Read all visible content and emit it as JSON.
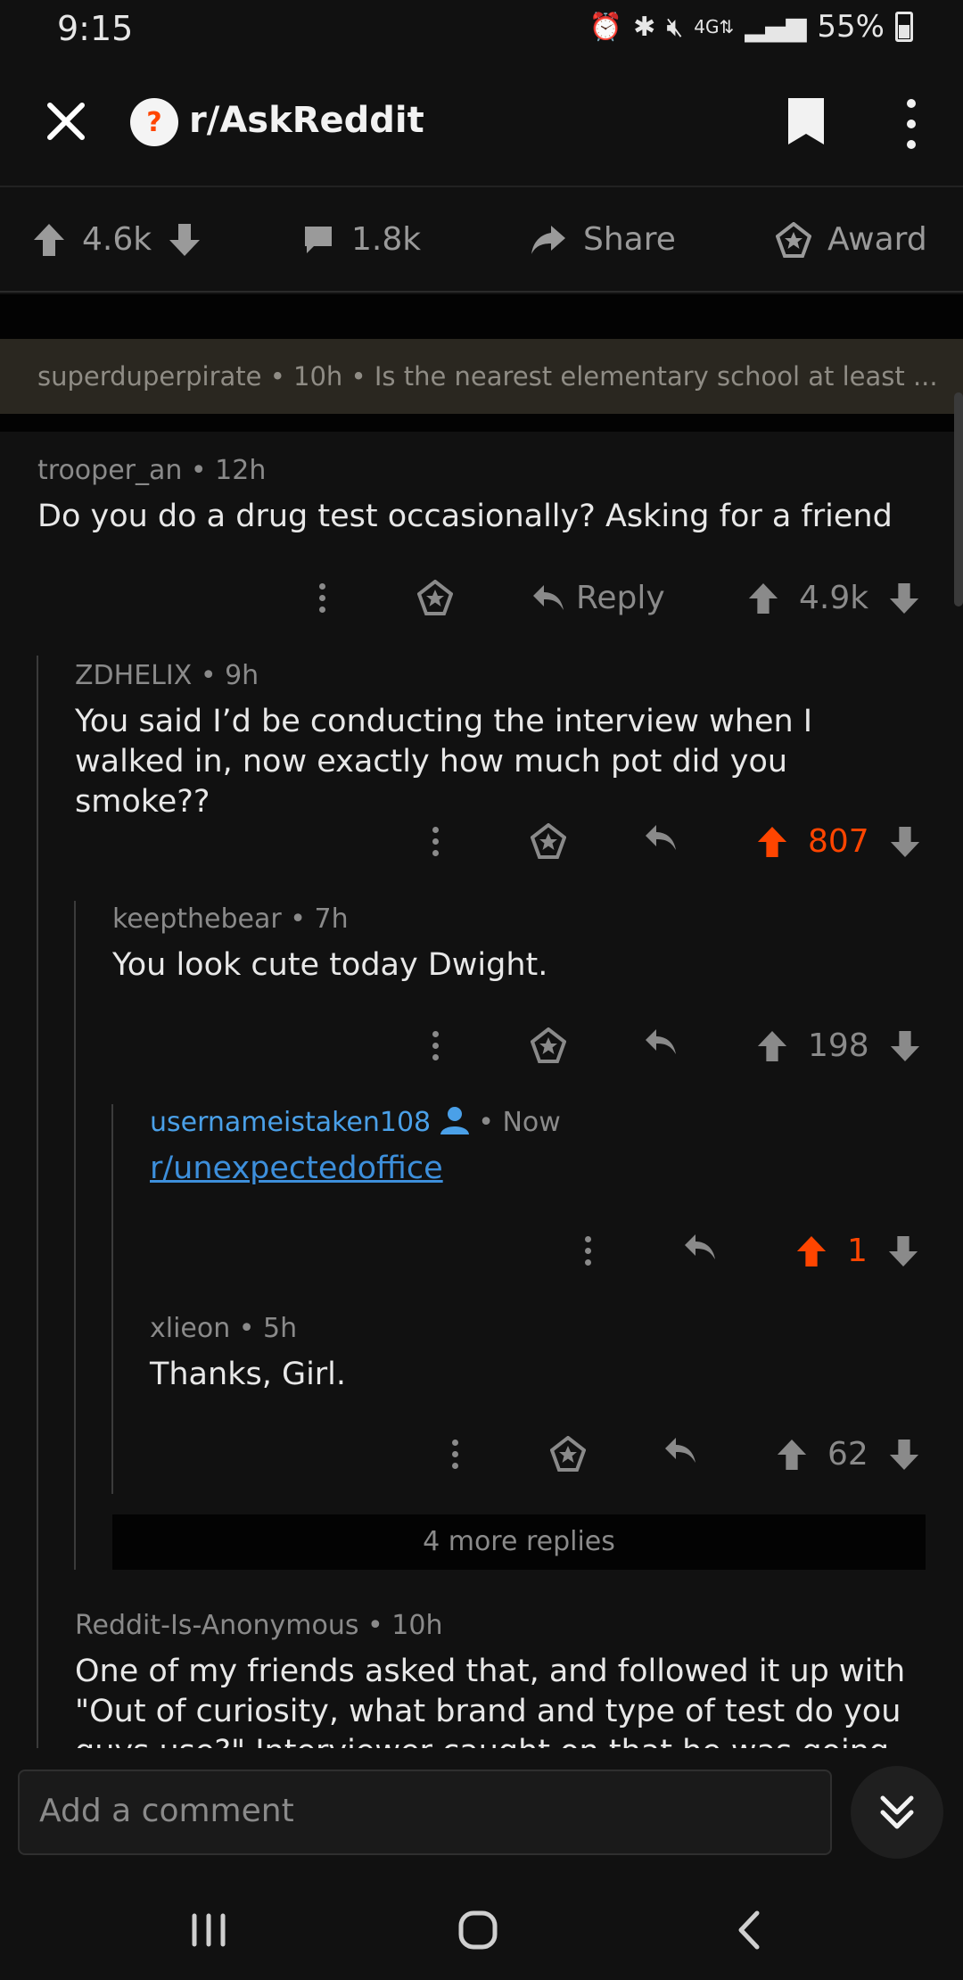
{
  "status": {
    "time": "9:15",
    "battery": "55%",
    "icons": [
      "alarm-icon",
      "bluetooth-icon",
      "mute-icon",
      "data-4g-icon",
      "signal-icon",
      "battery-icon"
    ]
  },
  "header": {
    "subreddit": "r/AskReddit",
    "avatar_glyph": "?",
    "close_icon": "close-icon",
    "bookmark_icon": "bookmark-icon",
    "more_icon": "more-vertical-icon"
  },
  "post_actions": {
    "upvotes": "4.6k",
    "comments": "1.8k",
    "share_label": "Share",
    "award_label": "Award"
  },
  "parent_context": {
    "author": "superduperpirate",
    "time": "10h",
    "text": "Is the nearest elementary school at least ..."
  },
  "comments": [
    {
      "author": "trooper_an",
      "time": "12h",
      "body": "Do you do a drug test occasionally? Asking for a friend",
      "reply_label": "Reply",
      "score": "4.9k"
    },
    {
      "author": "ZDHELIX",
      "time": "9h",
      "body": "You said I’d be conducting the interview when I walked in, now exactly how much pot did you smoke??",
      "score": "807"
    },
    {
      "author": "keepthebear",
      "time": "7h",
      "body": "You look cute today Dwight.",
      "score": "198"
    },
    {
      "author": "usernameistaken108",
      "time": "Now",
      "body": "r/unexpectedoffice",
      "score": "1"
    },
    {
      "author": "xlieon",
      "time": "5h",
      "body": "Thanks, Girl.",
      "score": "62"
    },
    {
      "author": "Reddit-Is-Anonymous",
      "time": "10h",
      "body": "One of my friends asked that, and followed it up with \"Out of curiosity, what brand and type of test do you guys use?\"  Interviewer caught on that he was going"
    }
  ],
  "more_replies": "4 more replies",
  "comment_bar": {
    "placeholder": "Add a comment"
  },
  "colors": {
    "background": "#111111",
    "upvote_active": "#ff4500",
    "link": "#3d8fdb",
    "op_author": "#4aa0e8"
  }
}
